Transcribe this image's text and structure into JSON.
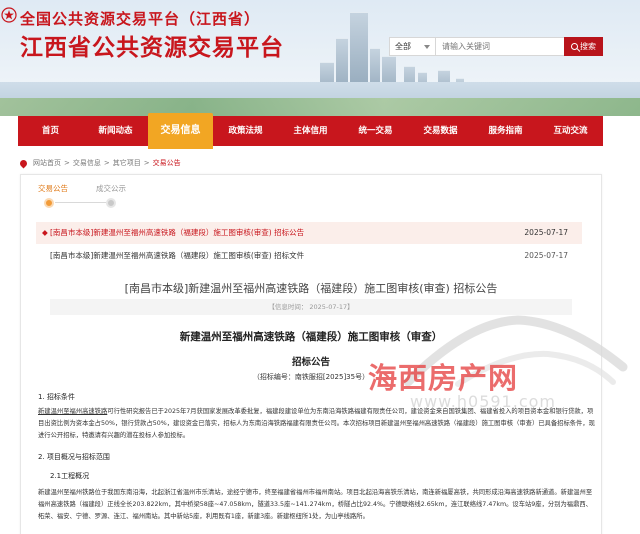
{
  "header": {
    "subtitle": "全国公共资源交易平台（江西省）",
    "title": "江西省公共资源交易平台"
  },
  "search": {
    "scope": "全部",
    "placeholder": "请输入关键词",
    "button_label": "搜索"
  },
  "nav": {
    "items": [
      {
        "label": "首页"
      },
      {
        "label": "新闻动态"
      },
      {
        "label": "交易信息"
      },
      {
        "label": "政策法规"
      },
      {
        "label": "主体信用"
      },
      {
        "label": "统一交易"
      },
      {
        "label": "交易数据"
      },
      {
        "label": "服务指南"
      },
      {
        "label": "互动交流"
      }
    ],
    "active_index": 2
  },
  "breadcrumb": {
    "items": [
      "网站首页",
      "交易信息",
      "其它项目",
      "交易公告"
    ]
  },
  "steps": {
    "items": [
      {
        "label": "交易公告",
        "state": "active"
      },
      {
        "label": "成交公示",
        "state": "pending"
      }
    ]
  },
  "project_list": {
    "rows": [
      {
        "title": "[南昌市本级]新建温州至福州高速铁路（福建段）施工图审核(审查) 招标公告",
        "date": "2025-07-17",
        "selected": true
      },
      {
        "title": "[南昌市本级]新建温州至福州高速铁路（福建段）施工图审核(审查) 招标文件",
        "date": "2025-07-17",
        "selected": false
      }
    ]
  },
  "document": {
    "title": "[南昌市本级]新建温州至福州高速铁路（福建段）施工图审核(审查) 招标公告",
    "meta": "【信息时间： 2025-07-17】",
    "heading": "新建温州至福州高速铁路（福建段）施工图审核（审查）",
    "subheading": "招标公告",
    "code": "（招标编号：南铁服招[2025]35号）",
    "section1": "1. 招标条件",
    "para1_lead": "新建温州至福州高速铁路",
    "para1_rest": "可行性研究报告已于2025年7月获国家发展改革委批复，福建段建设单位为东南沿海铁路福建有限责任公司，建设资金来自国铁集团、福建省投入的项目资本金和银行贷款，项目出资比例为资本金占50%，银行贷款占50%，建设资金已落实，招标人为东南沿海铁路福建有限责任公司。本次招标项目新建温州至福州高速铁路（福建段）施工图审核（审查）已具备招标条件，现进行公开招标，特邀请有兴趣的潜在投标人参加投标。",
    "section2": "2. 项目概况与招标范围",
    "section21": "2.1工程概况",
    "para2": "新建温州至福州铁路位于我国东南沿海，北起浙江省温州市乐清站，途经宁德市，终至福建省福州市福州南站。项目北起沿海高铁乐清站，南连新福厦高铁，共同形成沿海高速铁路新通道。新建温州至福州高速铁路（福建段）正线全长203.822km，其中桥梁58座~47.058km，隧道33.5座~141.274km，桥隧占比92.4%。宁德联络线2.65km，连江联络线7.47km。设车站9座，分别为福鼎西、柘荣、福安、宁德、罗源、连江、福州南站。其中新站5座，利用既有1座，新建3座。新建枢纽所1处，为山亭线路所。"
  },
  "watermark": {
    "title": "海西房产网",
    "url": "www.h0591.com"
  }
}
